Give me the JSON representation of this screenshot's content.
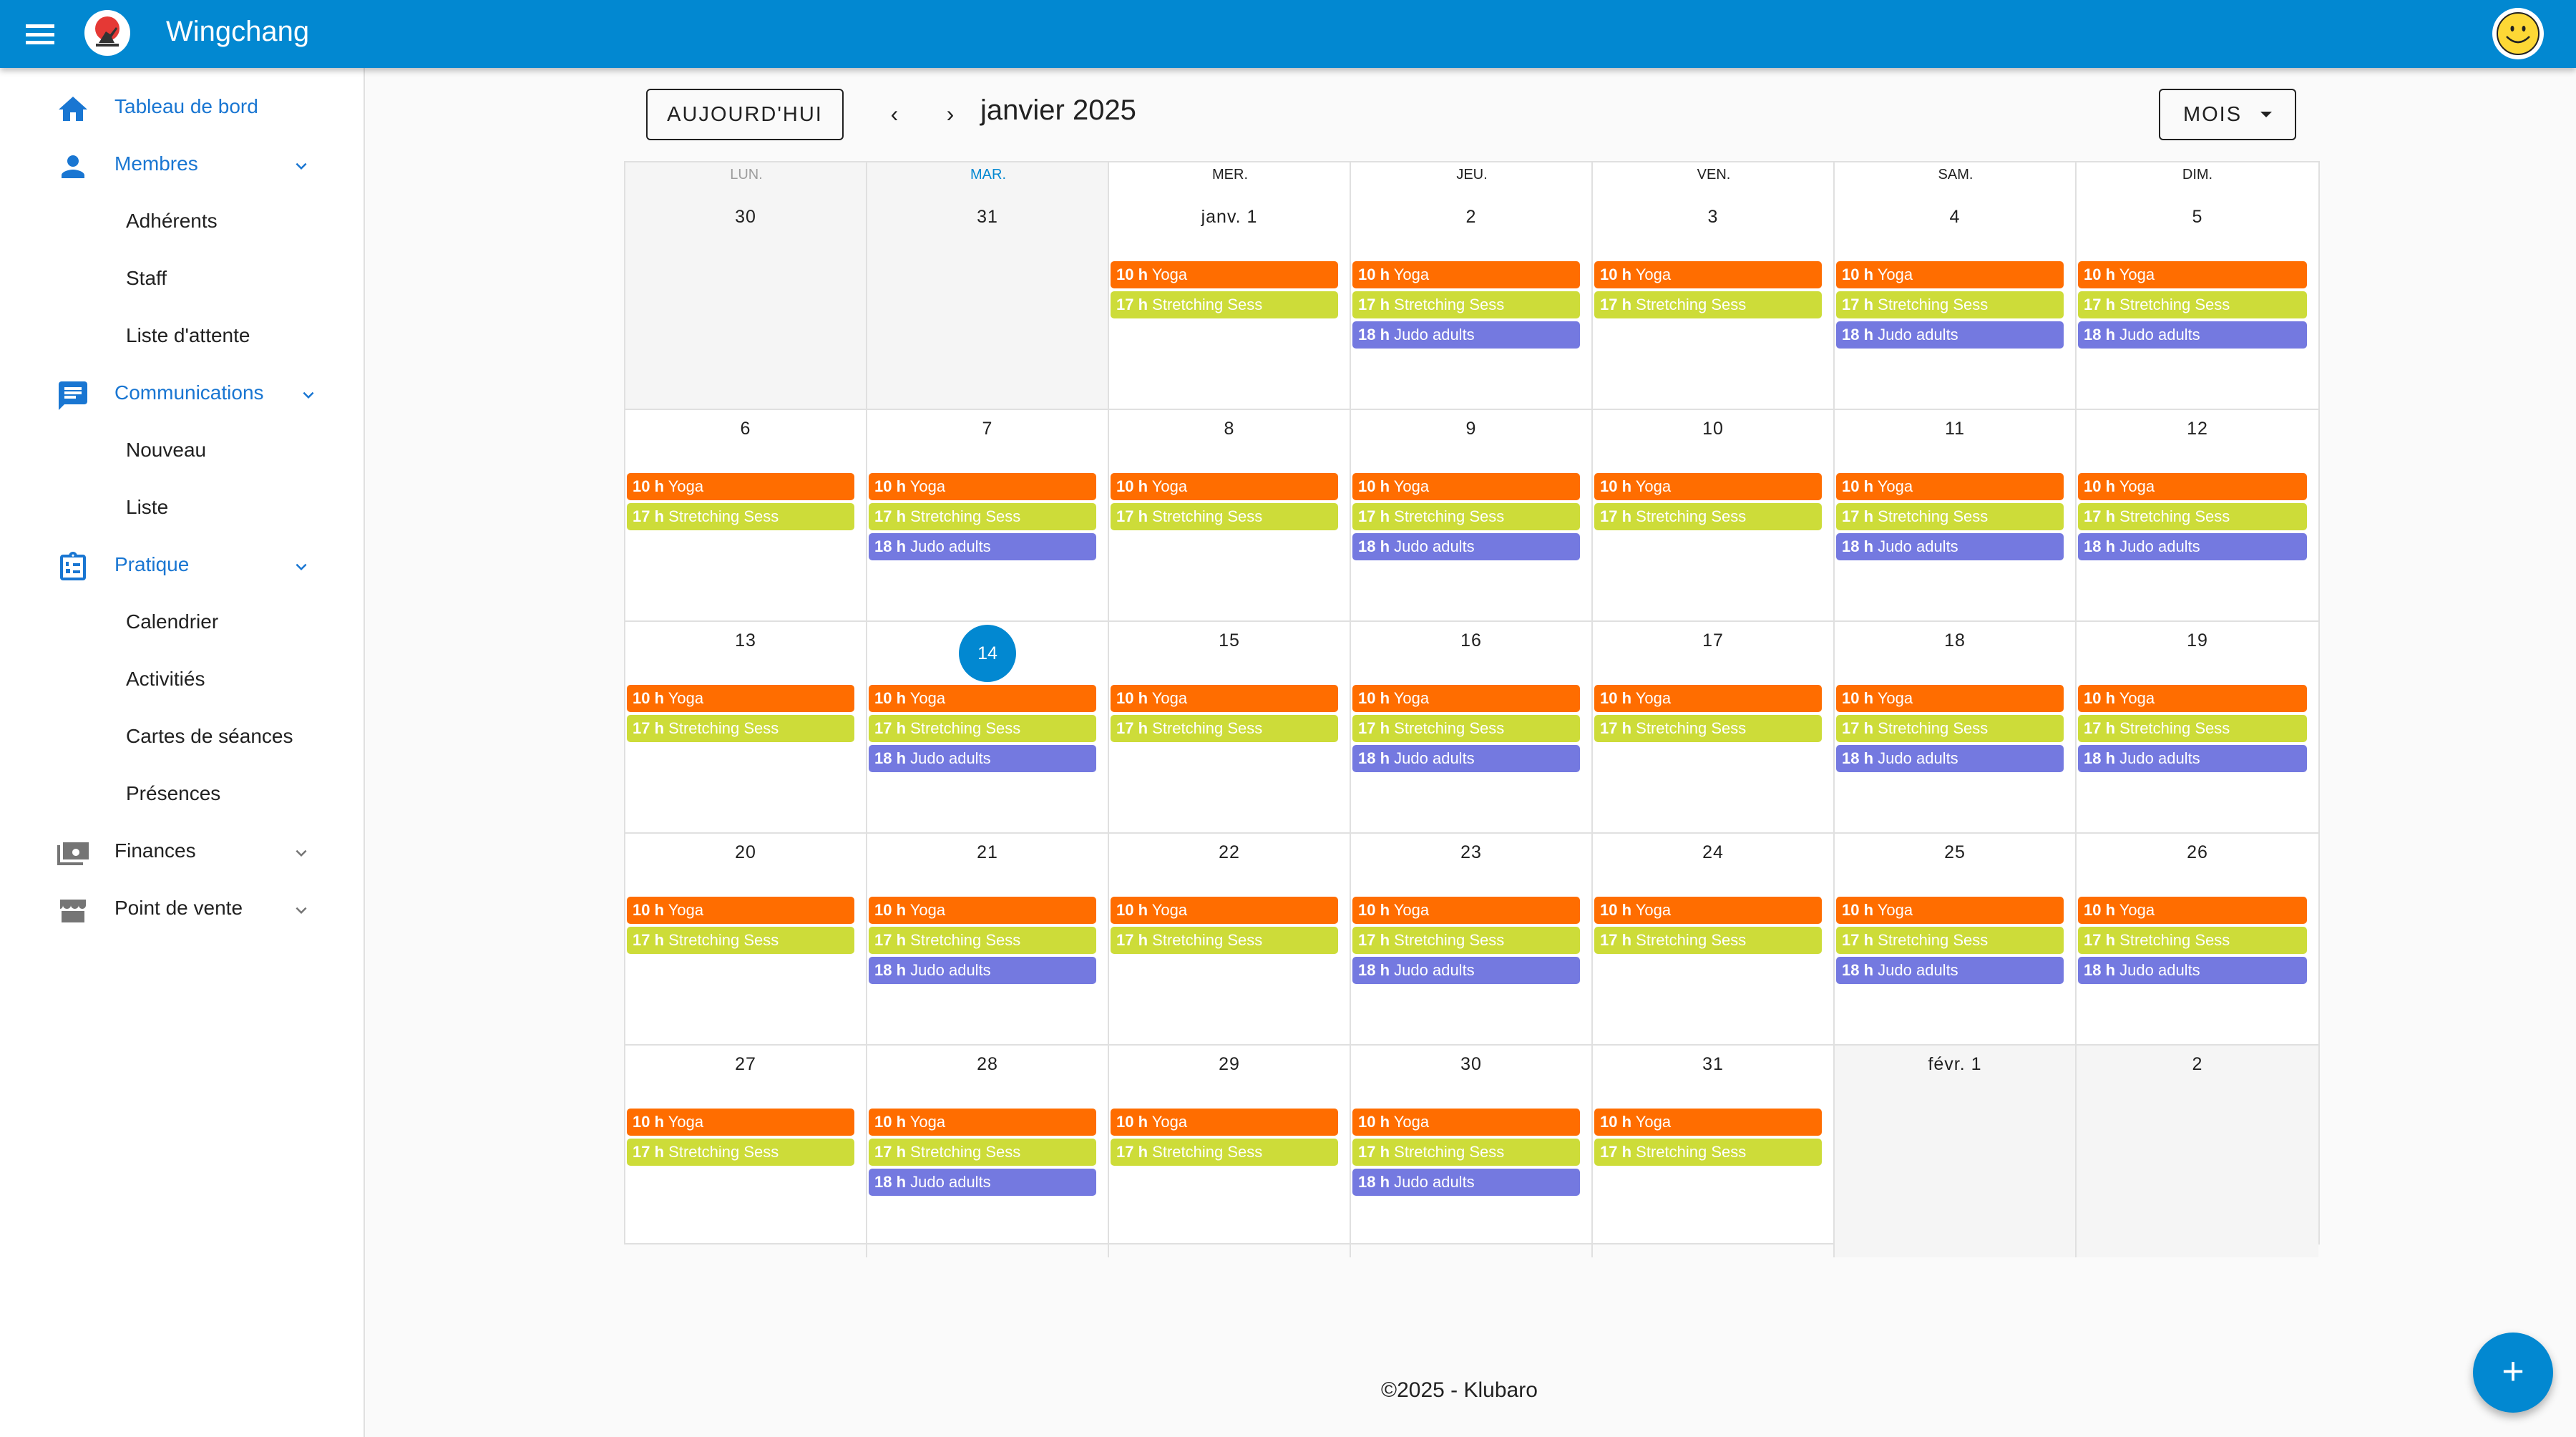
{
  "app": {
    "title": "Wingchang",
    "brand_color": "#0288d1"
  },
  "sidebar": {
    "items": [
      {
        "label": "Tableau de bord",
        "icon": "home-icon",
        "color": "blue",
        "expandable": false
      },
      {
        "label": "Membres",
        "icon": "person-icon",
        "color": "blue",
        "expandable": true,
        "children": [
          "Adhérents",
          "Staff",
          "Liste d'attente"
        ]
      },
      {
        "label": "Communications",
        "icon": "message-icon",
        "color": "blue",
        "expandable": true,
        "children": [
          "Nouveau",
          "Liste"
        ]
      },
      {
        "label": "Pratique",
        "icon": "clipboard-list-icon",
        "color": "blue",
        "expandable": true,
        "children": [
          "Calendrier",
          "Activitiés",
          "Cartes de séances",
          "Présences"
        ]
      },
      {
        "label": "Finances",
        "icon": "money-icon",
        "color": "grey",
        "expandable": true
      },
      {
        "label": "Point de vente",
        "icon": "store-icon",
        "color": "grey",
        "expandable": true
      }
    ]
  },
  "toolbar": {
    "today_label": "AUJOURD'HUI",
    "prev_label": "‹",
    "next_label": "›",
    "month_title": "janvier 2025",
    "view_label": "MOIS"
  },
  "calendar": {
    "weekdays": [
      "LUN.",
      "MAR.",
      "MER.",
      "JEU.",
      "VEN.",
      "SAM.",
      "DIM."
    ],
    "weekday_colors": [
      "#9e9e9e",
      "#0288d1",
      "#212121",
      "#212121",
      "#212121",
      "#212121",
      "#212121"
    ],
    "event_types": {
      "yoga": {
        "time": "10 h",
        "name": "Yoga",
        "color": "#ff6d00"
      },
      "stretch": {
        "time": "17 h",
        "name": "Stretching Sess",
        "color": "#cddc39"
      },
      "judo": {
        "time": "18 h",
        "name": "Judo adults",
        "color": "#7479e0"
      }
    },
    "weeks": [
      [
        {
          "label": "30",
          "outside": true,
          "events": []
        },
        {
          "label": "31",
          "outside": true,
          "events": []
        },
        {
          "label": "janv. 1",
          "events": [
            "yoga",
            "stretch"
          ]
        },
        {
          "label": "2",
          "events": [
            "yoga",
            "stretch",
            "judo"
          ]
        },
        {
          "label": "3",
          "events": [
            "yoga",
            "stretch"
          ]
        },
        {
          "label": "4",
          "events": [
            "yoga",
            "stretch",
            "judo"
          ]
        },
        {
          "label": "5",
          "events": [
            "yoga",
            "stretch",
            "judo"
          ]
        }
      ],
      [
        {
          "label": "6",
          "events": [
            "yoga",
            "stretch"
          ]
        },
        {
          "label": "7",
          "events": [
            "yoga",
            "stretch",
            "judo"
          ]
        },
        {
          "label": "8",
          "events": [
            "yoga",
            "stretch"
          ]
        },
        {
          "label": "9",
          "events": [
            "yoga",
            "stretch",
            "judo"
          ]
        },
        {
          "label": "10",
          "events": [
            "yoga",
            "stretch"
          ]
        },
        {
          "label": "11",
          "events": [
            "yoga",
            "stretch",
            "judo"
          ]
        },
        {
          "label": "12",
          "events": [
            "yoga",
            "stretch",
            "judo"
          ]
        }
      ],
      [
        {
          "label": "13",
          "events": [
            "yoga",
            "stretch"
          ]
        },
        {
          "label": "14",
          "today": true,
          "events": [
            "yoga",
            "stretch",
            "judo"
          ]
        },
        {
          "label": "15",
          "events": [
            "yoga",
            "stretch"
          ]
        },
        {
          "label": "16",
          "events": [
            "yoga",
            "stretch",
            "judo"
          ]
        },
        {
          "label": "17",
          "events": [
            "yoga",
            "stretch"
          ]
        },
        {
          "label": "18",
          "events": [
            "yoga",
            "stretch",
            "judo"
          ]
        },
        {
          "label": "19",
          "events": [
            "yoga",
            "stretch",
            "judo"
          ]
        }
      ],
      [
        {
          "label": "20",
          "events": [
            "yoga",
            "stretch"
          ]
        },
        {
          "label": "21",
          "events": [
            "yoga",
            "stretch",
            "judo"
          ]
        },
        {
          "label": "22",
          "events": [
            "yoga",
            "stretch"
          ]
        },
        {
          "label": "23",
          "events": [
            "yoga",
            "stretch",
            "judo"
          ]
        },
        {
          "label": "24",
          "events": [
            "yoga",
            "stretch"
          ]
        },
        {
          "label": "25",
          "events": [
            "yoga",
            "stretch",
            "judo"
          ]
        },
        {
          "label": "26",
          "events": [
            "yoga",
            "stretch",
            "judo"
          ]
        }
      ],
      [
        {
          "label": "27",
          "events": [
            "yoga",
            "stretch"
          ]
        },
        {
          "label": "28",
          "events": [
            "yoga",
            "stretch",
            "judo"
          ]
        },
        {
          "label": "29",
          "events": [
            "yoga",
            "stretch"
          ]
        },
        {
          "label": "30",
          "events": [
            "yoga",
            "stretch",
            "judo"
          ]
        },
        {
          "label": "31",
          "events": [
            "yoga",
            "stretch"
          ]
        },
        {
          "label": "févr. 1",
          "outside": true,
          "events": []
        },
        {
          "label": "2",
          "outside": true,
          "events": []
        }
      ]
    ]
  },
  "footer": {
    "text": "©2025 - Klubaro"
  },
  "fab": {
    "label": "+"
  }
}
